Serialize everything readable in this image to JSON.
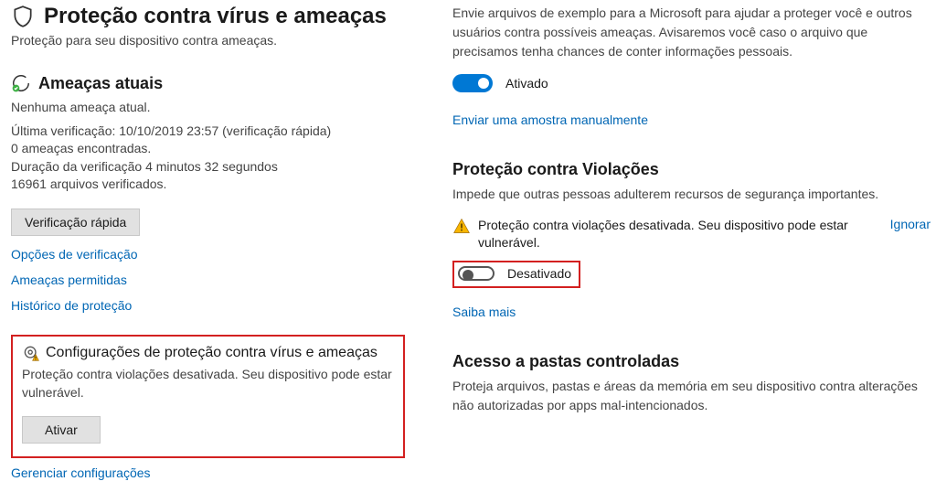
{
  "left": {
    "title": "Proteção contra vírus e ameaças",
    "subtitle": "Proteção para seu dispositivo contra ameaças.",
    "threats": {
      "head": "Ameaças atuais",
      "none": "Nenhuma ameaça atual.",
      "lastScan": "Última verificação: 10/10/2019 23:57 (verificação rápida)",
      "found": "0 ameaças encontradas.",
      "duration": "Duração da verificação 4 minutos 32 segundos",
      "filesScanned": "16961 arquivos verificados.",
      "quickScanBtn": "Verificação rápida",
      "linkOptions": "Opções de verificação",
      "linkAllowed": "Ameaças permitidas",
      "linkHistory": "Histórico de proteção"
    },
    "settingsBox": {
      "head": "Configurações de proteção contra vírus e ameaças",
      "warn": "Proteção contra violações desativada. Seu dispositivo pode estar vulnerável.",
      "enableBtn": "Ativar"
    },
    "manageLink": "Gerenciar configurações"
  },
  "right": {
    "sampleDesc": "Envie arquivos de exemplo para a Microsoft para ajudar a proteger você e outros usuários contra possíveis ameaças. Avisaremos você caso o arquivo que precisamos tenha chances de conter informações pessoais.",
    "toggleOnLabel": "Ativado",
    "sendSampleLink": "Enviar uma amostra manualmente",
    "tamperHead": "Proteção contra Violações",
    "tamperDesc": "Impede que outras pessoas adulterem recursos de segurança importantes.",
    "tamperWarn": "Proteção contra violações desativada. Seu dispositivo pode estar vulnerável.",
    "ignore": "Ignorar",
    "toggleOffLabel": "Desativado",
    "learnMore": "Saiba mais",
    "foldersHead": "Acesso a pastas controladas",
    "foldersDesc": "Proteja arquivos, pastas e áreas da memória em seu dispositivo contra alterações não autorizadas por apps mal-intencionados."
  }
}
